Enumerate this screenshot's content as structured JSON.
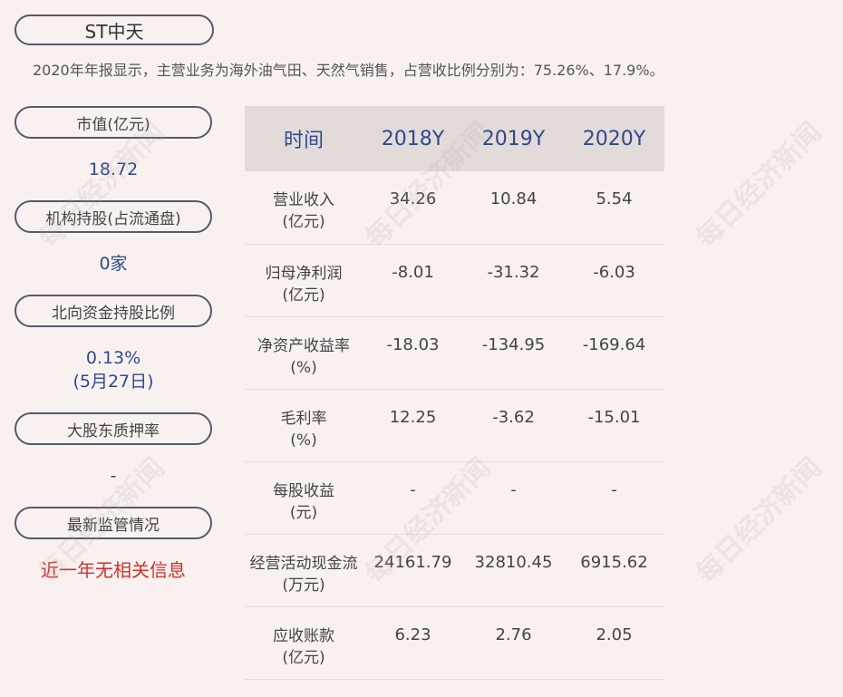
{
  "title": "ST中天",
  "summary": "2020年年报显示，主营业务为海外油气田、天然气销售，占营收比例分别为：75.26%、17.9%。",
  "left_panel": [
    {
      "label": "市值(亿元)",
      "value": "18.72"
    },
    {
      "label": "机构持股(占流通盘)",
      "value": "0家"
    },
    {
      "label": "北向资金持股比例",
      "value": "0.13%",
      "value2": "(5月27日)"
    },
    {
      "label": "大股东质押率",
      "value": "-"
    },
    {
      "label": "最新监管情况",
      "value": "近一年无相关信息"
    }
  ],
  "table": {
    "headers": [
      "时间",
      "2018Y",
      "2019Y",
      "2020Y"
    ],
    "rows": [
      {
        "label": "营业收入",
        "unit": "(亿元)",
        "values": [
          "34.26",
          "10.84",
          "5.54"
        ]
      },
      {
        "label": "归母净利润",
        "unit": "(亿元)",
        "values": [
          "-8.01",
          "-31.32",
          "-6.03"
        ]
      },
      {
        "label": "净资产收益率",
        "unit": "(%)",
        "values": [
          "-18.03",
          "-134.95",
          "-169.64"
        ]
      },
      {
        "label": "毛利率",
        "unit": "(%)",
        "values": [
          "12.25",
          "-3.62",
          "-15.01"
        ]
      },
      {
        "label": "每股收益",
        "unit": "(元)",
        "values": [
          "-",
          "-",
          "-"
        ]
      },
      {
        "label": "经营活动现金流",
        "unit": "(万元)",
        "values": [
          "24161.79",
          "32810.45",
          "6915.62"
        ]
      },
      {
        "label": "应收账款",
        "unit": "(亿元)",
        "values": [
          "6.23",
          "2.76",
          "2.05"
        ]
      }
    ]
  },
  "watermark": "每日经济新闻"
}
